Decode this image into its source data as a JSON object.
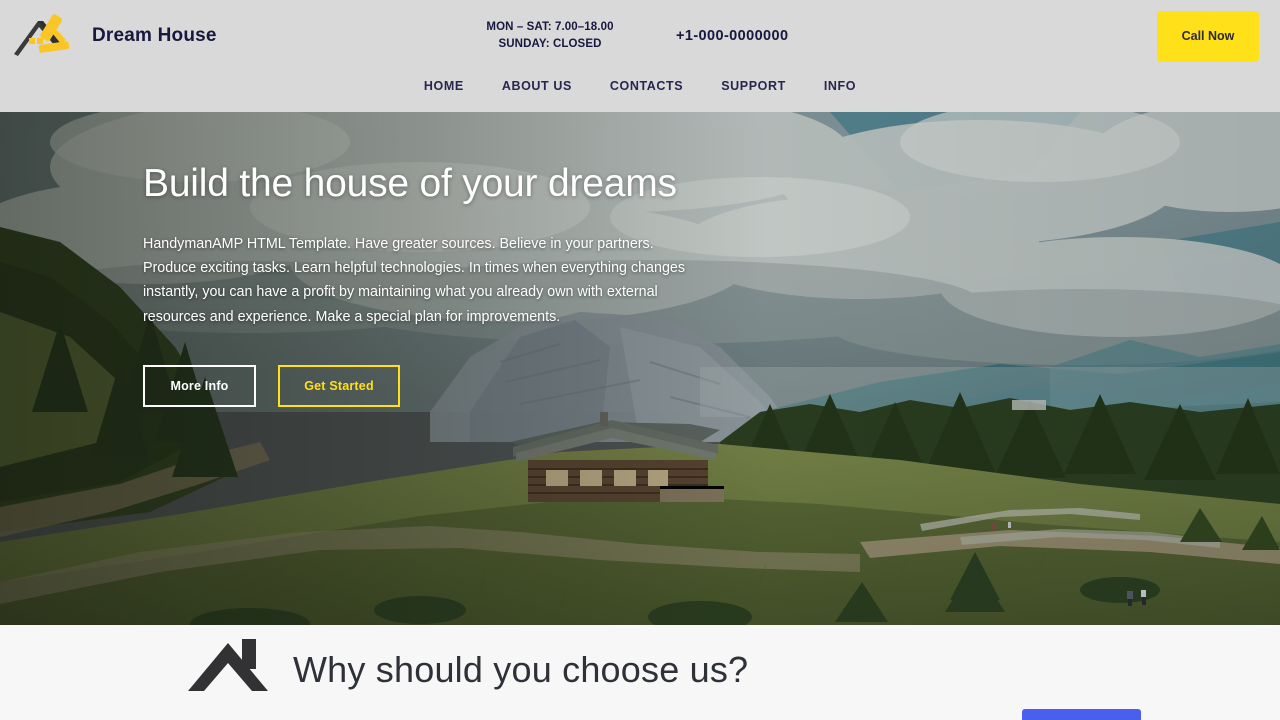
{
  "brand": {
    "name": "Dream House",
    "logo_icon": "house-roller-logo-icon",
    "logo_colors": {
      "roof": "#3a3a3c",
      "roller": "#f9c626"
    }
  },
  "header": {
    "background": "#d9d9d9",
    "text_color": "#17173f",
    "hours_line1": "MON – SAT: 7.00–18.00",
    "hours_line2": "SUNDAY: CLOSED",
    "phone": "+1-000-0000000",
    "call_button_label": "Call Now",
    "call_button_color": "#ffe019"
  },
  "nav": {
    "items": [
      {
        "label": "HOME"
      },
      {
        "label": "ABOUT US"
      },
      {
        "label": "CONTACTS"
      },
      {
        "label": "SUPPORT"
      },
      {
        "label": "INFO"
      }
    ]
  },
  "hero": {
    "title": "Build the house of your dreams",
    "paragraph": "HandymanAMP HTML Template. Have greater sources. Believe in your partners. Produce exciting tasks. Learn helpful technologies. In times when everything changes instantly, you can have a profit by maintaining what you already own with external resources and experience. Make a special plan for improvements.",
    "primary_button_label": "More Info",
    "secondary_button_label": "Get Started",
    "secondary_button_color": "#ffe019",
    "background_description": "Mountain meadow with wooden alpine cabin, conifer forest and cloudy sky"
  },
  "why_section": {
    "title": "Why should you choose us?",
    "icon": "house-roof-icon",
    "background": "#f7f7f7",
    "title_color": "#2e3138",
    "accent_bar_color": "#4a5ef0"
  }
}
